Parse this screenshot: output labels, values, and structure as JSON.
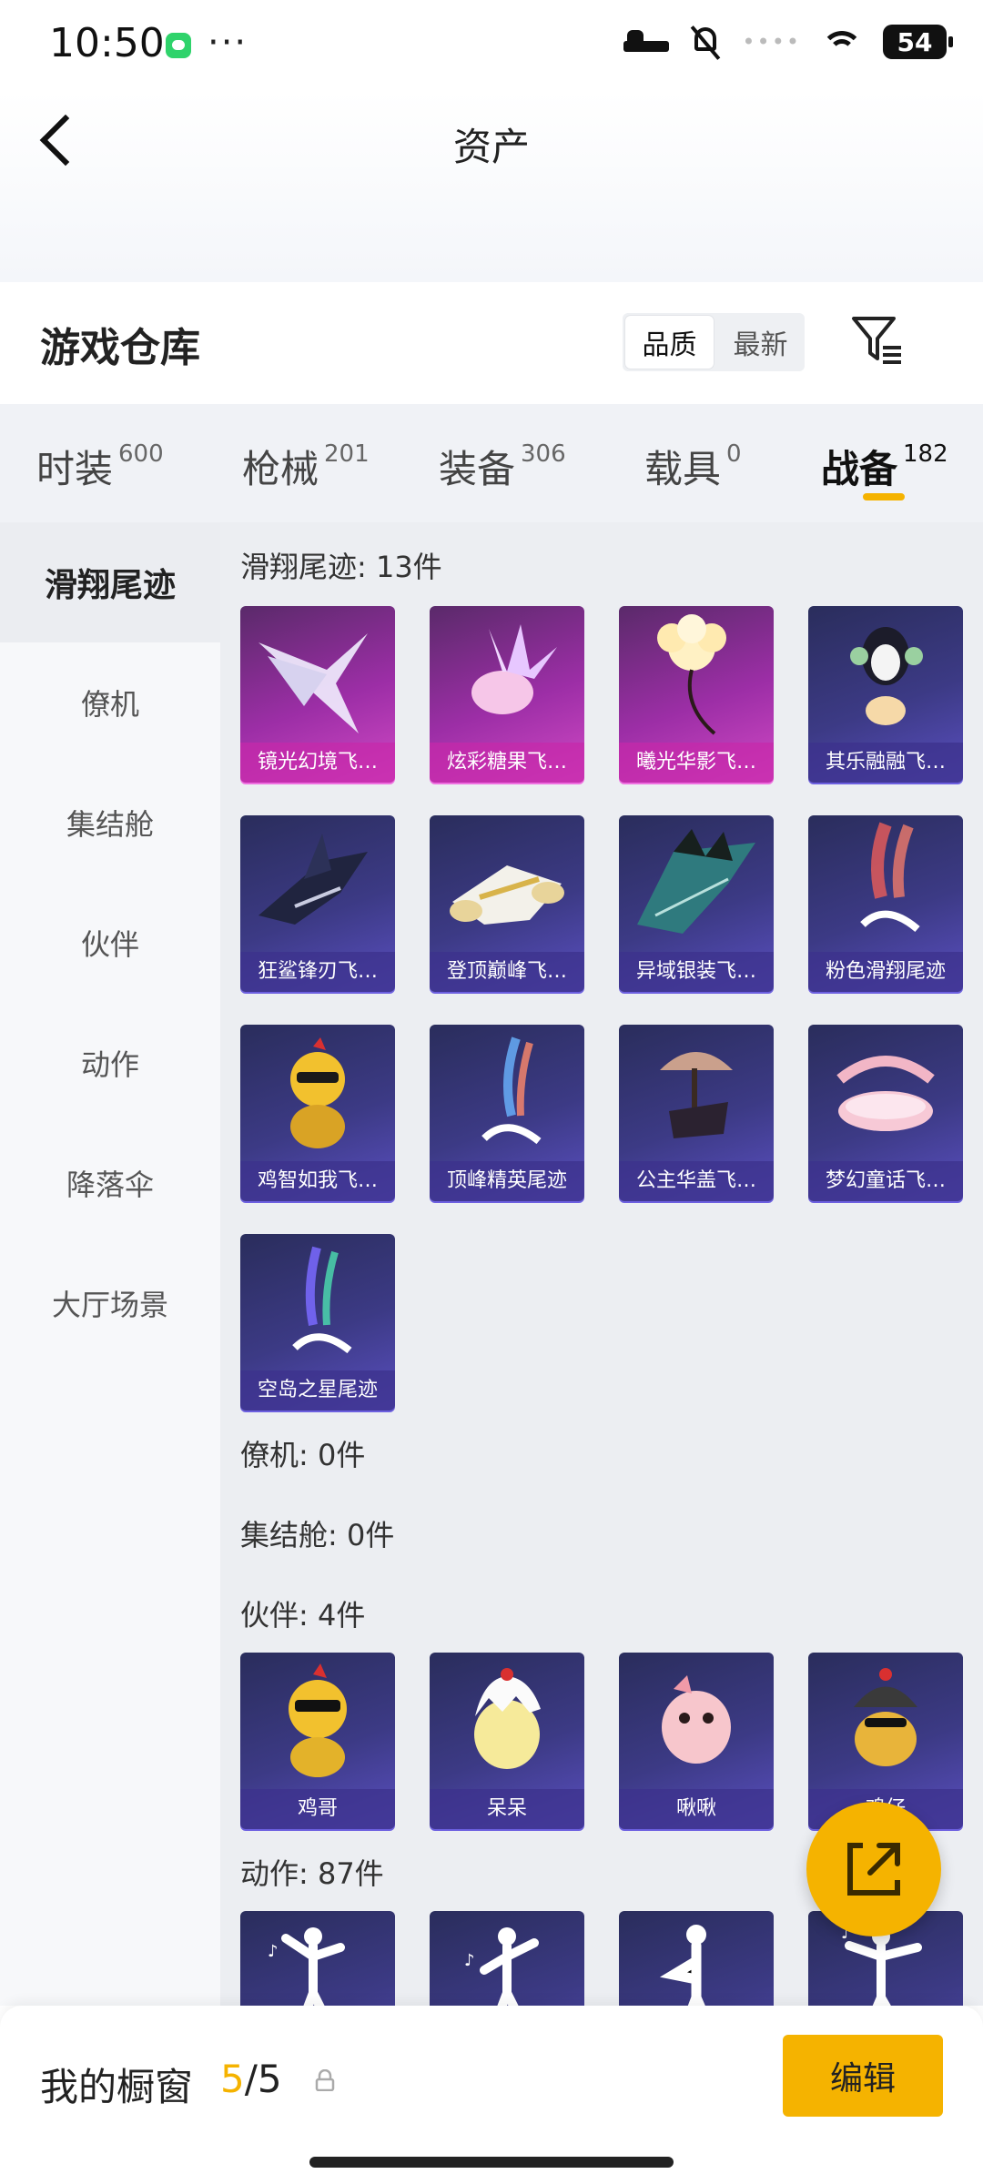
{
  "status_bar": {
    "time": "10:50",
    "dots": "···",
    "battery": "54"
  },
  "header": {
    "title": "资产"
  },
  "warehouse": {
    "title": "游戏仓库",
    "sort_options": [
      "品质",
      "最新"
    ]
  },
  "tabs": [
    {
      "label": "时装",
      "count": "600"
    },
    {
      "label": "枪械",
      "count": "201"
    },
    {
      "label": "装备",
      "count": "306"
    },
    {
      "label": "载具",
      "count": "0"
    },
    {
      "label": "战备",
      "count": "182"
    }
  ],
  "sidebar": [
    "滑翔尾迹",
    "僚机",
    "集结舱",
    "伙伴",
    "动作",
    "降落伞",
    "大厅场景"
  ],
  "sections": {
    "glide": {
      "heading": "滑翔尾迹: 13件",
      "items": [
        {
          "label": "镜光幻境飞…",
          "icon": "crystal-wings-icon",
          "rarity": "legendary"
        },
        {
          "label": "炫彩糖果飞…",
          "icon": "candy-glider-icon",
          "rarity": "legendary"
        },
        {
          "label": "曦光华影飞…",
          "icon": "golden-flower-icon",
          "rarity": "legendary"
        },
        {
          "label": "其乐融融飞…",
          "icon": "penguin-glider-icon",
          "rarity": "epic"
        },
        {
          "label": "狂鲨锋刃飞…",
          "icon": "shark-glider-icon",
          "rarity": "epic"
        },
        {
          "label": "登顶巅峰飞…",
          "icon": "jet-glider-icon",
          "rarity": "epic"
        },
        {
          "label": "异域银装飞…",
          "icon": "silver-wings-icon",
          "rarity": "epic"
        },
        {
          "label": "粉色滑翔尾迹",
          "icon": "pink-smoke-trail-icon",
          "rarity": "epic"
        },
        {
          "label": "鸡智如我飞…",
          "icon": "chicken-glider-icon",
          "rarity": "epic"
        },
        {
          "label": "顶峰精英尾迹",
          "icon": "rainbow-trail-icon",
          "rarity": "epic"
        },
        {
          "label": "公主华盖飞…",
          "icon": "canopy-glider-icon",
          "rarity": "epic"
        },
        {
          "label": "梦幻童话飞…",
          "icon": "fairytale-bed-icon",
          "rarity": "epic"
        },
        {
          "label": "空岛之星尾迹",
          "icon": "sky-star-trail-icon",
          "rarity": "epic"
        }
      ]
    },
    "wingman": {
      "heading": "僚机: 0件"
    },
    "pod": {
      "heading": "集结舱: 0件"
    },
    "partner": {
      "heading": "伙伴: 4件",
      "items": [
        {
          "label": "鸡哥",
          "icon": "chicken-sunglasses-icon"
        },
        {
          "label": "呆呆",
          "icon": "chick-egg-icon"
        },
        {
          "label": "啾啾",
          "icon": "pink-bird-icon"
        },
        {
          "label": "鸡仔",
          "icon": "chick-helmet-icon"
        }
      ]
    },
    "emote": {
      "heading": "动作: 87件",
      "items": [
        {
          "icon": "dance-pose-icon"
        },
        {
          "icon": "dance-pose-icon"
        },
        {
          "icon": "dance-pose-icon"
        },
        {
          "icon": "dance-pose-icon"
        }
      ]
    }
  },
  "showcase": {
    "label": "我的橱窗",
    "current": "5",
    "total": "/5"
  },
  "edit_button": "编辑",
  "colors": {
    "accent": "#f5b300",
    "epic": "#3c3a85",
    "legendary": "#b43bb8"
  }
}
